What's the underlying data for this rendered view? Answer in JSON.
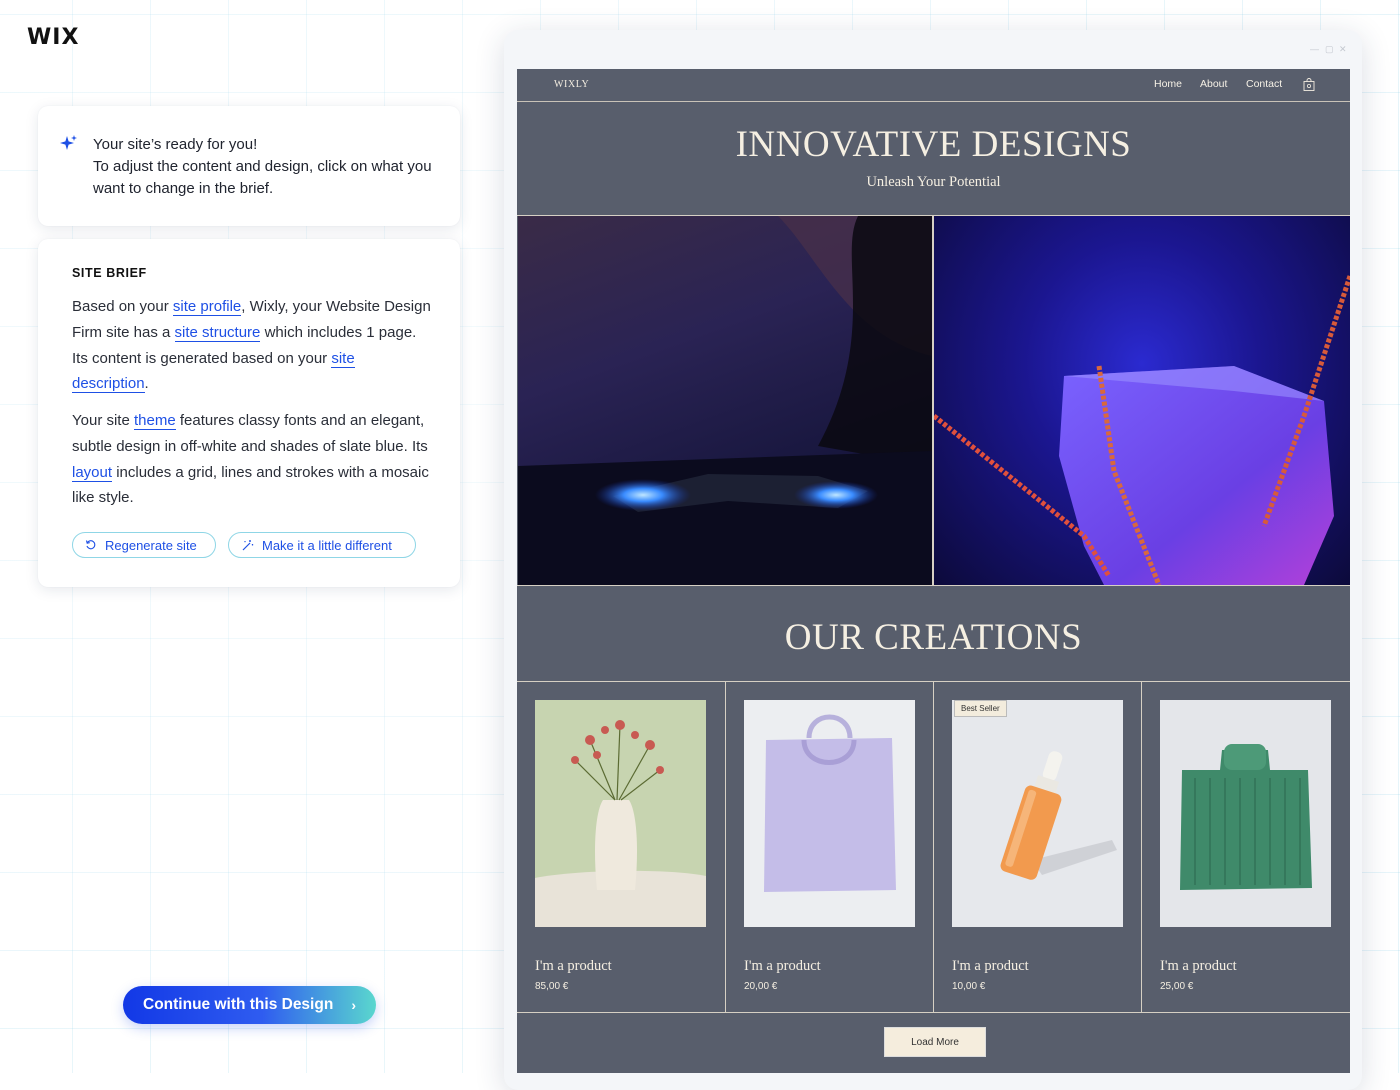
{
  "app": {
    "logo": "WIX"
  },
  "assistant": {
    "line1": "Your site’s ready for you!",
    "line2": "To adjust the content and design, click on what you want to change in the brief."
  },
  "brief": {
    "title": "SITE BRIEF",
    "p1": {
      "t1": "Based on your ",
      "link1": "site profile",
      "t2": ", Wixly, your Website Design Firm site has a ",
      "link2": "site structure",
      "t3": " which includes 1 page. Its content is generated based on your ",
      "link3": "site description",
      "t4": "."
    },
    "p2": {
      "t1": "Your site ",
      "link1": "theme",
      "t2": " features classy fonts and an elegant, subtle design in off-white and shades of slate blue. Its ",
      "link2": "layout",
      "t3": " includes a grid, lines and strokes with a mosaic like style."
    },
    "regenerate_label": "Regenerate site",
    "different_label": "Make it a little different"
  },
  "cta": {
    "label": "Continue with this Design"
  },
  "preview": {
    "brand": "WIXLY",
    "nav": [
      "Home",
      "About",
      "Contact"
    ],
    "hero_title": "INNOVATIVE DESIGNS",
    "hero_subtitle": "Unleash Your Potential",
    "section_title": "OUR CREATIONS",
    "products": [
      {
        "name": "I'm a product",
        "price": "85,00 €",
        "badge": ""
      },
      {
        "name": "I'm a product",
        "price": "20,00 €",
        "badge": ""
      },
      {
        "name": "I'm a product",
        "price": "10,00 €",
        "badge": "Best Seller"
      },
      {
        "name": "I'm a product",
        "price": "25,00 €",
        "badge": ""
      }
    ],
    "load_more": "Load More"
  },
  "colors": {
    "accent": "#1e50e5",
    "site_bg": "#585e6c",
    "site_text": "#f5efe2"
  }
}
